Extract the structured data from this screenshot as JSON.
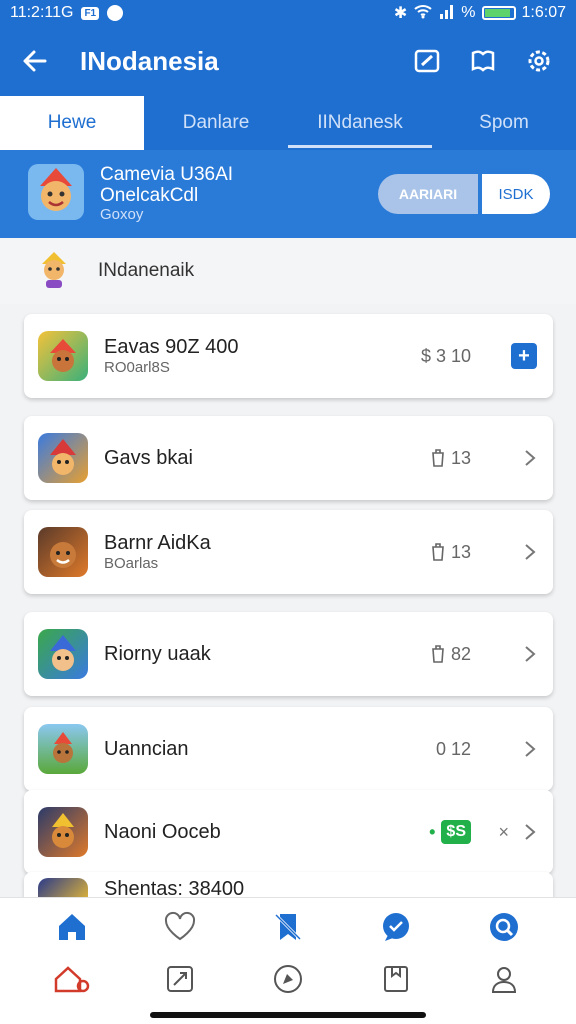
{
  "status_bar": {
    "time_left": "11:2:11G",
    "badge": "F1",
    "signal": "%",
    "time_right": "1:6:07"
  },
  "app_bar": {
    "title": "INodanesia"
  },
  "tabs": [
    {
      "label": "Hewe"
    },
    {
      "label": "Danlare"
    },
    {
      "label": "IINdanesk"
    },
    {
      "label": "Spom"
    }
  ],
  "banner": {
    "line1": "Camevia U36AI",
    "line2": "OnelcakCdl",
    "line3": "Goxoy",
    "btn_primary": "AARIARI",
    "btn_secondary": "ISDK"
  },
  "section": {
    "label": "INdanenaik"
  },
  "list": [
    {
      "name": "Eavas 90Z 400",
      "sub": "RO0arl8S",
      "meta": "$ 3 10"
    },
    {
      "name": "Gavs bkai",
      "sub": "",
      "meta": "13"
    },
    {
      "name": "Barnr AidKa",
      "sub": "BOarlas",
      "meta": "13"
    },
    {
      "name": "Riorny uaak",
      "sub": "",
      "meta": "82"
    },
    {
      "name": "Uanncian",
      "sub": "",
      "meta": "0 12"
    },
    {
      "name": "Naoni Ooceb",
      "sub": "",
      "meta": "$S"
    },
    {
      "name": "Shentas: 38400",
      "sub": "",
      "meta": ""
    }
  ],
  "colors": {
    "primary": "#1f6fd1",
    "accent_green": "#22b04a",
    "home_red": "#d23a2a"
  }
}
